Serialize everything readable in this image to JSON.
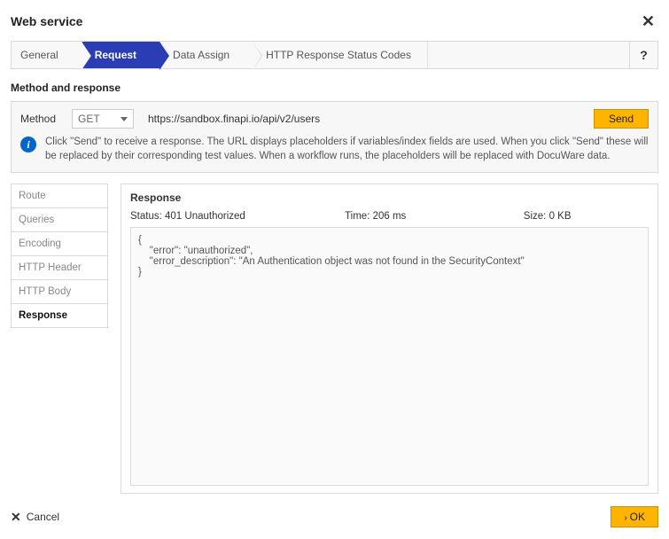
{
  "dialog": {
    "title": "Web service"
  },
  "tabs": {
    "general": "General",
    "request": "Request",
    "data_assign": "Data Assign",
    "http_codes": "HTTP Response Status Codes",
    "help": "?"
  },
  "section": {
    "method_response": "Method and response"
  },
  "method_row": {
    "label": "Method",
    "verb": "GET",
    "url": "https://sandbox.finapi.io/api/v2/users",
    "send": "Send"
  },
  "info": {
    "text": "Click \"Send\" to receive a response. The URL displays placeholders if variables/index fields are used. When you click \"Send\" these will be replaced by their corresponding test values. When a workflow runs, the placeholders will be replaced with DocuWare data."
  },
  "side_tabs": {
    "route": "Route",
    "queries": "Queries",
    "encoding": "Encoding",
    "http_header": "HTTP Header",
    "http_body": "HTTP Body",
    "response": "Response"
  },
  "response": {
    "title": "Response",
    "status_label": "Status:",
    "status_value": "401 Unauthorized",
    "time_label": "Time:",
    "time_value": "206 ms",
    "size_label": "Size:",
    "size_value": "0 KB",
    "body": "{\n    \"error\": \"unauthorized\",\n    \"error_description\": \"An Authentication object was not found in the SecurityContext\"\n}"
  },
  "footer": {
    "cancel": "Cancel",
    "ok": "OK"
  }
}
